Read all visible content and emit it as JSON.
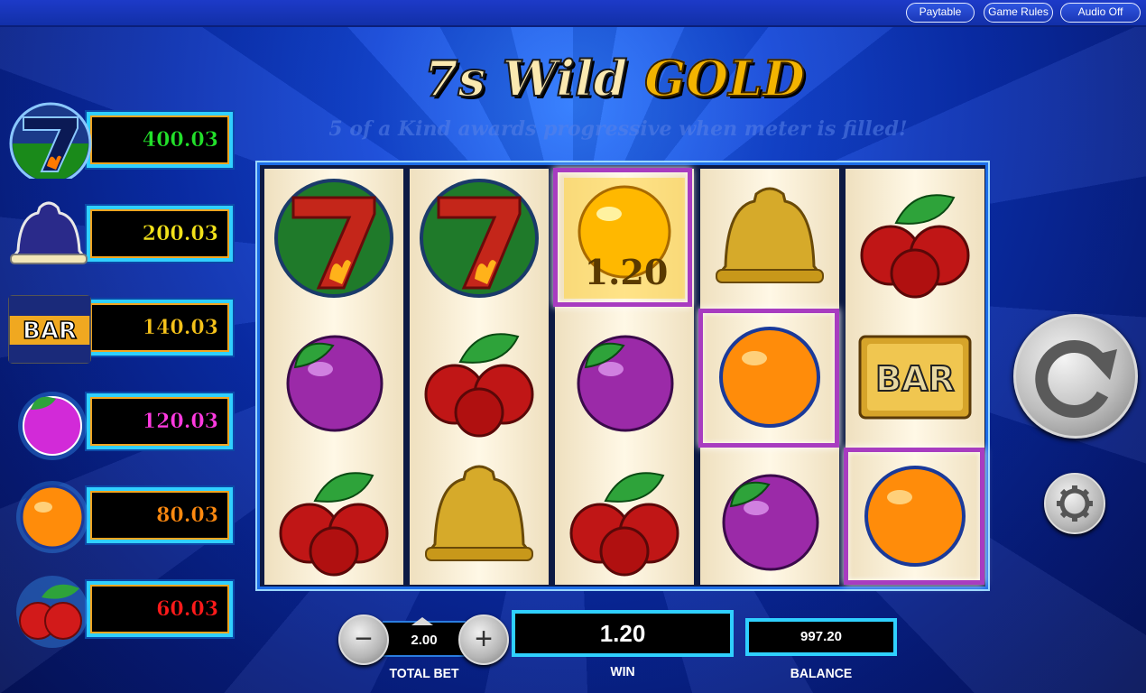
{
  "topbar": {
    "paytable_label": "Paytable",
    "game_rules_label": "Game Rules",
    "audio_label": "Audio Off"
  },
  "title": {
    "part1": "7s Wild ",
    "part2": "GOLD",
    "subtitle": "5 of a Kind awards progressive when meter is filled!"
  },
  "paytable": [
    {
      "symbol": "seven-icon",
      "value": "400.03",
      "color": "#22e02a"
    },
    {
      "symbol": "bell-icon",
      "value": "200.03",
      "color": "#f2e21a"
    },
    {
      "symbol": "bar-icon",
      "value": "140.03",
      "color": "#f5c21a"
    },
    {
      "symbol": "plum-icon",
      "value": "120.03",
      "color": "#ff3ae0"
    },
    {
      "symbol": "orange-icon",
      "value": "80.03",
      "color": "#ff8a10"
    },
    {
      "symbol": "cherry-icon",
      "value": "60.03",
      "color": "#ff1a1a"
    }
  ],
  "reels": [
    [
      "seven",
      "plum",
      "cherry"
    ],
    [
      "seven",
      "cherry",
      "bell"
    ],
    [
      "lemon",
      "plum",
      "cherry"
    ],
    [
      "bell",
      "orange",
      "plum"
    ],
    [
      "cherry",
      "bar",
      "orange"
    ]
  ],
  "win_highlight_label": "1.20",
  "bet": {
    "minus_label": "−",
    "plus_label": "+",
    "value": "2.00",
    "label": "TOTAL BET"
  },
  "win": {
    "value": "1.20",
    "label": "WIN"
  },
  "balance": {
    "value": "997.20",
    "label": "BALANCE"
  },
  "colors": {
    "accent_cyan": "#2fd0ff",
    "win_frame": "#a83cc0",
    "background_blue": "#0a2fb0"
  }
}
